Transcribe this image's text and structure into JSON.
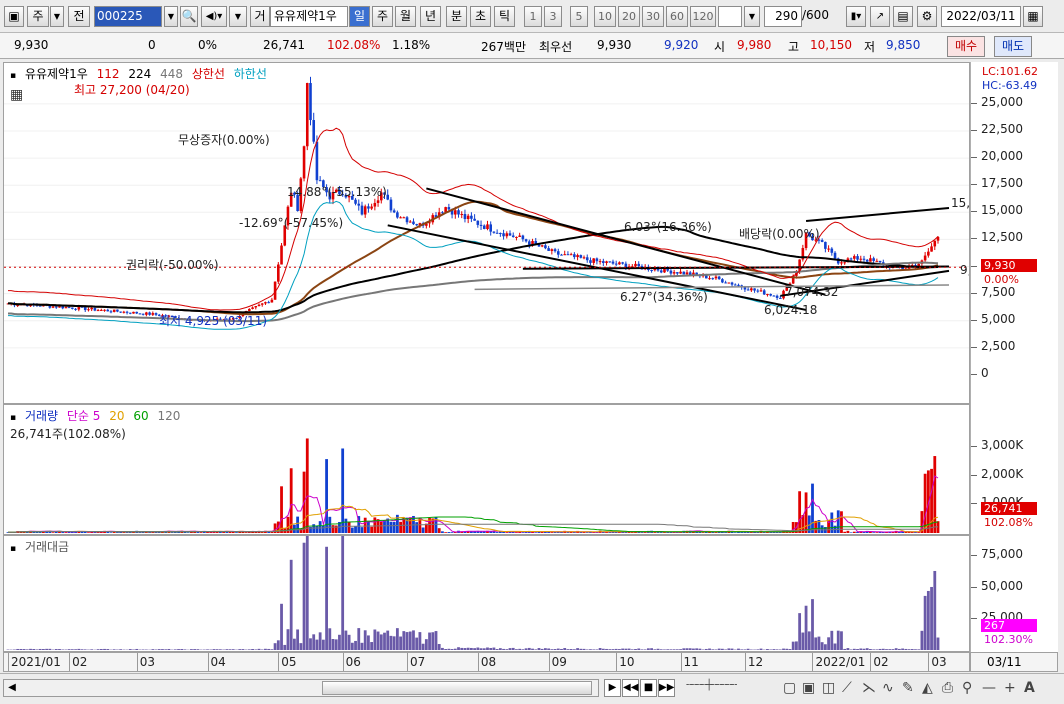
{
  "toolbar": {
    "market_type": "주",
    "prev_label": "전",
    "stock_code": "000225",
    "stock_name": "유유제약1우",
    "daily_tab": "거",
    "periods": [
      "일",
      "주",
      "월",
      "년",
      "분",
      "초",
      "틱"
    ],
    "selected_period": "일",
    "interval_buttons": [
      "1",
      "3",
      "5",
      "10",
      "20",
      "30",
      "60",
      "120"
    ],
    "count_value": "290",
    "count_total": "/600",
    "date": "2022/03/11"
  },
  "quote": {
    "price": "9,930",
    "change": "0",
    "change_rate": "0%",
    "volume": "26,741",
    "volume_ratio": "102.08%",
    "turnover": "1.18%",
    "amount": "267백만",
    "best_ask_label": "최우선",
    "best_ask": "9,930",
    "best_bid": "9,920",
    "open_label": "시",
    "open": "9,980",
    "high_label": "고",
    "high": "10,150",
    "low_label": "저",
    "low": "9,850",
    "buy_label": "매수",
    "sell_label": "매도"
  },
  "price_pane": {
    "legend_name": "유유제약1우",
    "ma_labels": [
      {
        "label": "112",
        "color": "#d40000"
      },
      {
        "label": "224",
        "color": "#000000"
      },
      {
        "label": "448",
        "color": "#777777"
      },
      {
        "label": "상한선",
        "color": "#d40000"
      },
      {
        "label": "하한선",
        "color": "#00a0c0"
      }
    ],
    "lc_label": "LC:101.62",
    "hc_label": "HC:-63.49",
    "current_price_tag": "9,930",
    "current_rate_tag": "0.00%",
    "y_ticks": [
      "25,000",
      "22,500",
      "20,000",
      "17,500",
      "15,000",
      "12,500",
      "10,000",
      "7,500",
      "5,000",
      "2,500",
      "0"
    ],
    "annotations": {
      "high": "최고 27,200 (04/20)",
      "low": "최저 4,925 (03/11)",
      "bonus_issue": "무상증자(0.00%)",
      "rights_issue": "권리락(-50.00%)",
      "dividend": "배당락(0.00%)",
      "line1": "14.88°(-55.13%)",
      "line2": "-12.69°(-57.45%)",
      "line3": "6.03°(16.36%)",
      "line4": "6.27°(34.36%)",
      "v1": "7,074.32",
      "v2": "6,024.18",
      "end_upper": "15,",
      "end_mid": "9,"
    }
  },
  "volume_pane": {
    "title": "거래량",
    "ma_labels": [
      {
        "label": "단순 5",
        "color": "#cc00cc"
      },
      {
        "label": "20",
        "color": "#e0a000"
      },
      {
        "label": "60",
        "color": "#00a000"
      },
      {
        "label": "120",
        "color": "#777777"
      }
    ],
    "summary": "26,741주(102.08%)",
    "y_ticks": [
      "3,000K",
      "2,000K",
      "1,000K"
    ],
    "tag_volume": "26,741",
    "tag_ratio": "102.08%"
  },
  "amount_pane": {
    "title": "거래대금",
    "y_ticks": [
      "75,000",
      "50,000",
      "25,000"
    ],
    "tag_amount": "267",
    "tag_ratio": "102.30%"
  },
  "dates": {
    "labels": [
      "2021/01",
      "02",
      "03",
      "04",
      "05",
      "06",
      "07",
      "08",
      "09",
      "10",
      "11",
      "12",
      "2022/01",
      "02",
      "03"
    ],
    "end_label": "03/11"
  },
  "chart_data": {
    "type": "candlestick",
    "price_ylim": [
      0,
      26000
    ],
    "current_price": 9930,
    "high_point": {
      "date": "04/20",
      "value": 27200
    },
    "low_point": {
      "date": "03/11",
      "value": 4925
    },
    "volume_ylim": [
      0,
      3700
    ],
    "amount_ylim": [
      0,
      80000
    ]
  },
  "colors": {
    "up": "#e00000",
    "down": "#1040d0",
    "ma112": "#d40000",
    "ma224": "#000000",
    "ma448": "#777777",
    "upper_band": "#d40000",
    "lower_band": "#00a0c0",
    "amount_bar": "#6a5aa8"
  }
}
